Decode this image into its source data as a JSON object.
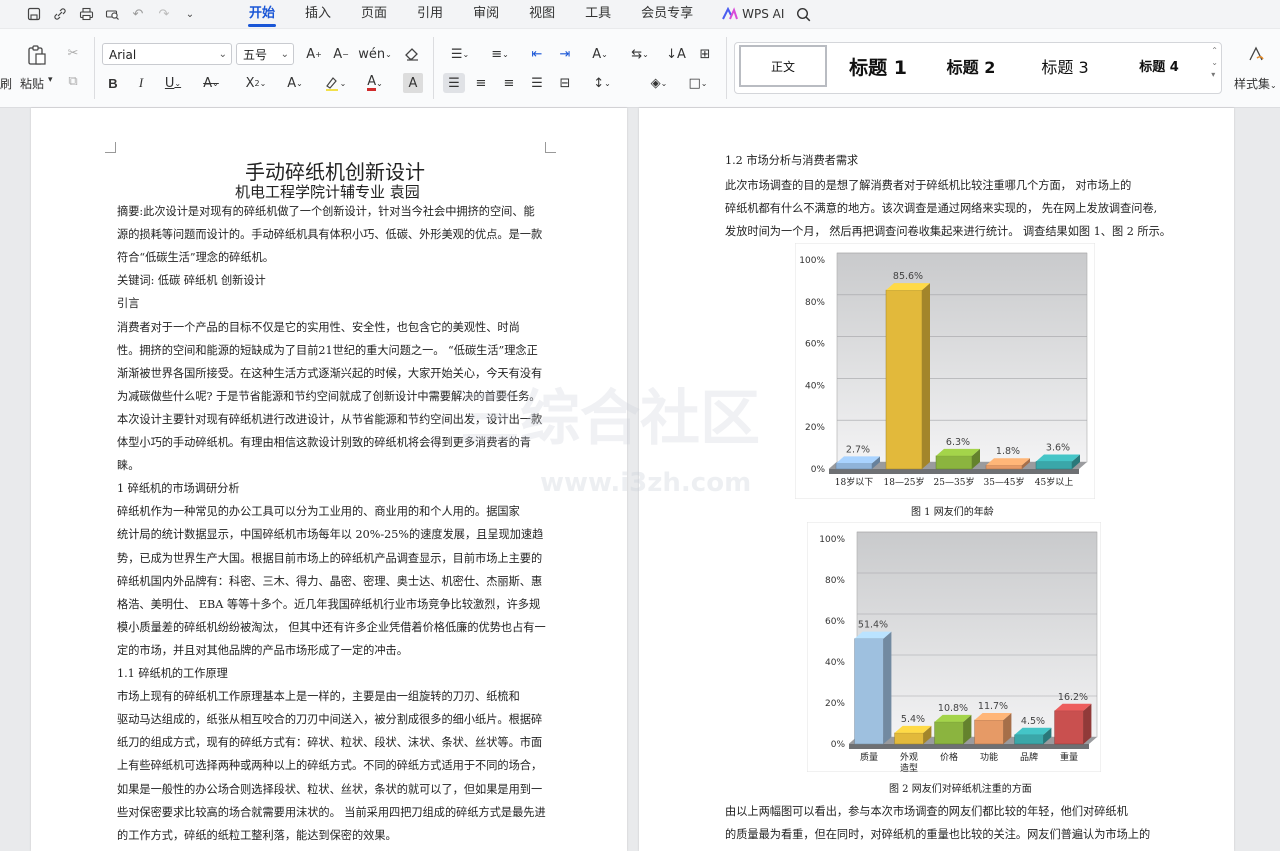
{
  "toolbar": {
    "tabs": [
      "开始",
      "插入",
      "页面",
      "引用",
      "审阅",
      "视图",
      "工具",
      "会员专享"
    ],
    "active_tab": "开始",
    "wps_ai": "WPS AI"
  },
  "ribbon": {
    "paste_label": "粘贴",
    "clipboard_label_partial": "刷",
    "font_name": "Arial",
    "font_size": "五号",
    "styles": [
      "正文",
      "标题 1",
      "标题 2",
      "标题 3",
      "标题 4"
    ],
    "styles_set_label": "样式集"
  },
  "page1": {
    "title": "手动碎纸机创新设计",
    "subtitle": "机电工程学院计辅专业      袁园",
    "lines": [
      "摘要:此次设计是对现有的碎纸机做了一个创新设计，针对当今社会中拥挤的空间、能",
      "源的损耗等问题而设计的。手动碎纸机具有体积小巧、低碳、外形美观的优点。是一款",
      "符合“低碳生活”理念的碎纸机。",
      "关键词: 低碳   碎纸机   创新设计",
      "        引言",
      "        消费者对于一个产品的目标不仅是它的实用性、安全性，也包含它的美观性、时尚",
      "性。拥挤的空间和能源的短缺成为了目前21世纪的重大问题之一。  “低碳生活”理念正",
      "渐渐被世界各国所接受。在这种生活方式逐渐兴起的时候，大家开始关心，今天有没有",
      "为减碳做些什么呢? 于是节省能源和节约空间就成了创新设计中需要解决的首要任务。",
      "本次设计主要针对现有碎纸机进行改进设计，从节省能源和节约空间出发，设计出一款",
      "体型小巧的手动碎纸机。有理由相信这款设计别致的碎纸机将会得到更多消费者的青",
      "睐。",
      "1   碎纸机的市场调研分析",
      "        碎纸机作为一种常见的办公工具可以分为工业用的、商业用的和个人用的。据国家",
      "统计局的统计数据显示，中国碎纸机市场每年以  20%-25%的速度发展，且呈现加速趋",
      "势，已成为世界生产大国。根据目前市场上的碎纸机产品调查显示，目前市场上主要的",
      "碎纸机国内外品牌有：科密、三木、得力、晶密、密理、奥士达、机密仕、杰丽斯、惠",
      "格浩、美明仕、    EBA 等等十多个。近几年我国碎纸机行业市场竞争比较激烈，许多规",
      "模小质量差的碎纸机纷纷被淘汰，  但其中还有许多企业凭借着价格低廉的优势也占有一",
      "定的市场，并且对其他品牌的产品市场形成了一定的冲击。",
      "1.1    碎纸机的工作原理",
      "        市场上现有的碎纸机工作原理基本上是一样的，主要是由一组旋转的刀刃、纸梳和",
      "驱动马达组成的，纸张从相互咬合的刀刃中间送入，被分割成很多的细小纸片。根据碎",
      "纸刀的组成方式，现有的碎纸方式有：碎状、粒状、段状、沫状、条状、丝状等。市面",
      "上有些碎纸机可选择两种或两种以上的碎纸方式。不同的碎纸方式适用于不同的场合，",
      "如果是一般性的办公场合则选择段状、粒状、丝状，条状的就可以了，但如果是用到一",
      "些对保密要求比较高的场合就需要用沫状的。  当前采用四把刀组成的碎纸方式是最先进",
      "的工作方式，碎纸的纸粒工整利落，能达到保密的效果。"
    ]
  },
  "page2": {
    "heading": "1.2    市场分析与消费者需求",
    "intro_lines": [
      "        此次市场调查的目的是想了解消费者对于碎纸机比较注重哪几个方面，  对市场上的",
      "碎纸机都有什么不满意的地方。该次调查是通过网络来实现的，  先在网上发放调查问卷,",
      "发放时间为一个月，  然后再把调查问卷收集起来进行统计。  调查结果如图 1、图 2 所示。"
    ],
    "outro_lines": [
      "        由以上两幅图可以看出，参与本次市场调查的网友们都比较的年轻，他们对碎纸机",
      "的质量最为看重，但在同时，对碎纸机的重量也比较的关注。网友们普遍认为市场上的"
    ]
  },
  "chart_data": [
    {
      "type": "bar",
      "caption": "图 1    网友们的年龄",
      "categories": [
        "18岁以下",
        "18—25岁",
        "25—35岁",
        "35—45岁",
        "45岁以上"
      ],
      "values": [
        2.7,
        85.6,
        6.3,
        1.8,
        3.6
      ],
      "value_labels": [
        "2.7%",
        "85.6%",
        "6.3%",
        "1.8%",
        "3.6%"
      ],
      "ylim": [
        0,
        100
      ],
      "ticks": [
        "0%",
        "20%",
        "40%",
        "60%",
        "80%",
        "100%"
      ],
      "colors": [
        "#8fb3d9",
        "#e2b93b",
        "#8bb43f",
        "#e69a66",
        "#3aa7a9"
      ]
    },
    {
      "type": "bar",
      "caption": "图 2    网友们对碎纸机注重的方面",
      "categories": [
        "质量",
        "外观造型",
        "价格",
        "功能",
        "品牌",
        "重量"
      ],
      "values": [
        51.4,
        5.4,
        10.8,
        11.7,
        4.5,
        16.2
      ],
      "value_labels": [
        "51.4%",
        "5.4%",
        "10.8%",
        "11.7%",
        "4.5%",
        "16.2%"
      ],
      "ylim": [
        0,
        100
      ],
      "ticks": [
        "0%",
        "20%",
        "40%",
        "60%",
        "80%",
        "100%"
      ],
      "colors": [
        "#9ec0df",
        "#e2b93b",
        "#8bb43f",
        "#e69a66",
        "#3aa7a9",
        "#c9504f"
      ]
    }
  ]
}
